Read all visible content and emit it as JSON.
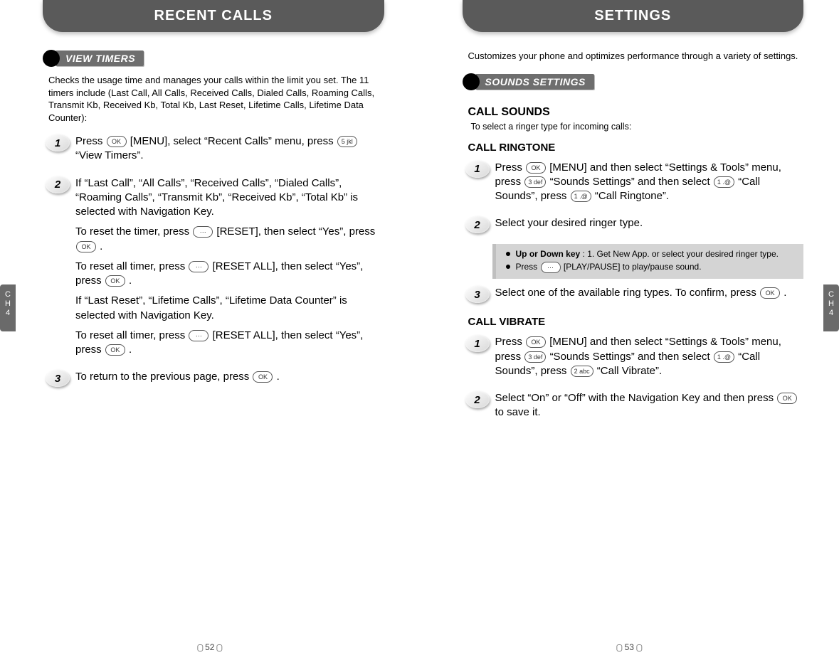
{
  "left": {
    "title": "RECENT CALLS",
    "section_label": "VIEW TIMERS",
    "intro": "Checks the usage time and manages your calls within the limit you set. The 11 timers include (Last Call, All Calls, Received Calls, Dialed Calls, Roaming Calls, Transmit Kb, Received Kb, Total Kb, Last Reset, Lifetime Calls, Lifetime Data Counter):",
    "steps": {
      "s1": {
        "num": "1",
        "line1_a": "Press ",
        "line1_b": " [MENU], select “Recent Calls” menu, press ",
        "line1_c": " “View Timers”.",
        "key_ok": "OK",
        "key_5": "5 jkl"
      },
      "s2": {
        "num": "2",
        "p1": "If “Last Call”, “All Calls”, “Received Calls”, “Dialed Calls”, “Roaming Calls”, “Transmit Kb”, “Received Kb”, “Total Kb” is selected with Navigation Key.",
        "p2a": "To reset the timer, press ",
        "p2b": " [RESET], then select “Yes”, press ",
        "p2c": " .",
        "p3a": "To reset all timer, press ",
        "p3b": " [RESET ALL], then select “Yes”, press ",
        "p3c": " .",
        "p4": "If “Last Reset”, “Lifetime Calls”, “Lifetime Data Counter” is selected with Navigation Key.",
        "p5a": "To reset all timer, press ",
        "p5b": " [RESET ALL], then select “Yes”, press ",
        "p5c": " .",
        "key_soft": "⋯",
        "key_ok": "OK"
      },
      "s3": {
        "num": "3",
        "a": "To return to the previous page, press ",
        "b": " .",
        "key_ok": "OK"
      }
    },
    "page_num": "52",
    "chapter": "C\nH\n4"
  },
  "right": {
    "title": "SETTINGS",
    "intro": "Customizes your phone and optimizes performance through a variety of settings.",
    "section_label": "SOUNDS SETTINGS",
    "call_sounds_heading": "CALL SOUNDS",
    "call_sounds_caption": "To select a ringer type for incoming calls:",
    "call_ringtone_heading": "CALL RINGTONE",
    "ringtone_steps": {
      "s1": {
        "num": "1",
        "a": "Press ",
        "b": " [MENU] and then select “Settings & Tools” menu, press ",
        "c": " “Sounds Settings” and then select ",
        "d": " “Call Sounds”, press ",
        "e": " “Call Ringtone”.",
        "key_ok": "OK",
        "key_3": "3 def",
        "key_1a": "1 .@",
        "key_1b": "1 .@"
      },
      "s2": {
        "num": "2",
        "text": "Select your desired ringer type."
      },
      "note": {
        "row1_label": "Up or Down key",
        "row1_text": " : 1. Get New App. or select your desired ringer type.",
        "row2_a": "Press ",
        "row2_key": "⋯",
        "row2_b": " [PLAY/PAUSE] to play/pause sound."
      },
      "s3": {
        "num": "3",
        "a": "Select one of the available ring types. To confirm, press ",
        "b": " .",
        "key_ok": "OK"
      }
    },
    "call_vibrate_heading": "CALL VIBRATE",
    "vibrate_steps": {
      "s1": {
        "num": "1",
        "a": "Press ",
        "b": " [MENU] and then select “Settings & Tools” menu, press ",
        "c": " “Sounds Settings” and then select ",
        "d": " “Call Sounds”, press ",
        "e": " “Call Vibrate”.",
        "key_ok": "OK",
        "key_3": "3 def",
        "key_1": "1 .@",
        "key_2": "2 abc"
      },
      "s2": {
        "num": "2",
        "a": "Select “On” or “Off” with the Navigation Key and then press ",
        "b": " to save it.",
        "key_ok": "OK"
      }
    },
    "page_num": "53",
    "chapter": "C\nH\n4"
  }
}
